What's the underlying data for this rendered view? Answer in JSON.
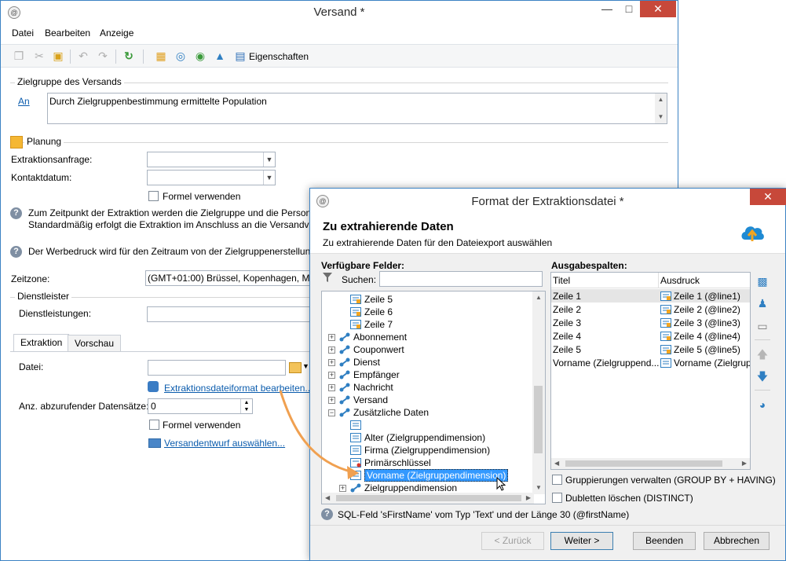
{
  "main_window": {
    "title": "Versand *",
    "menu": [
      "Datei",
      "Bearbeiten",
      "Anzeige"
    ],
    "toolbar": {
      "properties_label": "Eigenschaften"
    },
    "target": {
      "group_label": "Zielgruppe des Versands",
      "to_link": "An",
      "population_text": "Durch Zielgruppenbestimmung ermittelte Population"
    },
    "planning": {
      "label": "Planung",
      "extraction_request_label": "Extraktionsanfrage:",
      "contact_date_label": "Kontaktdatum:",
      "formula_checkbox": "Formel verwenden",
      "info1_line1": "Zum Zeitpunkt der Extraktion werden die Zielgruppe und die Person",
      "info1_line2": "Standardmäßig erfolgt die Extraktion im Anschluss an die Versandva",
      "info2": "Der Werbedruck wird für den Zeitraum von der Zielgruppenerstellun"
    },
    "timezone": {
      "label": "Zeitzone:",
      "value": "(GMT+01:00) Brüssel, Kopenhagen, Ma"
    },
    "service_provider": {
      "group_label": "Dienstleister",
      "services_label": "Dienstleistungen:"
    },
    "tabs": [
      "Extraktion",
      "Vorschau"
    ],
    "extraction": {
      "file_label": "Datei:",
      "format_link": "Extraktionsdateiformat bearbeiten...",
      "records_label": "Anz. abzurufender Datensätze:",
      "records_value": "0",
      "formula_checkbox": "Formel verwenden",
      "template_link": "Versandentwurf auswählen..."
    }
  },
  "dialog": {
    "title": "Format der Extraktionsdatei *",
    "heading": "Zu extrahierende Daten",
    "subheading": "Zu extrahierende Daten für den Dateiexport auswählen",
    "available_label": "Verfügbare Felder:",
    "search_label": "Suchen:",
    "search_value": "",
    "tree": [
      {
        "label": "Zeile 5",
        "indent": 2,
        "type": "line"
      },
      {
        "label": "Zeile 6",
        "indent": 2,
        "type": "line"
      },
      {
        "label": "Zeile 7",
        "indent": 2,
        "type": "line"
      },
      {
        "label": "Abonnement",
        "indent": 1,
        "type": "link",
        "expander": "+"
      },
      {
        "label": "Couponwert",
        "indent": 1,
        "type": "link",
        "expander": "+"
      },
      {
        "label": "Dienst",
        "indent": 1,
        "type": "link",
        "expander": "+"
      },
      {
        "label": "Empfänger",
        "indent": 1,
        "type": "link",
        "expander": "+"
      },
      {
        "label": "Nachricht",
        "indent": 1,
        "type": "link",
        "expander": "+"
      },
      {
        "label": "Versand",
        "indent": 1,
        "type": "link",
        "expander": "+"
      },
      {
        "label": "Zusätzliche Daten",
        "indent": 1,
        "type": "link",
        "expander": "−"
      },
      {
        "label": "",
        "indent": 2,
        "type": "field"
      },
      {
        "label": "Alter (Zielgruppendimension)",
        "indent": 2,
        "type": "field"
      },
      {
        "label": "Firma (Zielgruppendimension)",
        "indent": 2,
        "type": "field"
      },
      {
        "label": "Primärschlüssel",
        "indent": 2,
        "type": "key"
      },
      {
        "label": "Vorname (Zielgruppendimension)",
        "indent": 2,
        "type": "field",
        "selected": true
      },
      {
        "label": "Zielgruppendimension",
        "indent": 2,
        "type": "link",
        "expander": "+"
      }
    ],
    "output_label": "Ausgabespalten:",
    "output_columns": [
      "Titel",
      "Ausdruck"
    ],
    "output_rows": [
      {
        "title": "Zeile 1",
        "expression": "Zeile 1 (@line1)"
      },
      {
        "title": "Zeile 2",
        "expression": "Zeile 2 (@line2)"
      },
      {
        "title": "Zeile 3",
        "expression": "Zeile 3 (@line3)"
      },
      {
        "title": "Zeile 4",
        "expression": "Zeile 4 (@line4)"
      },
      {
        "title": "Zeile 5",
        "expression": "Zeile 5 (@line5)"
      },
      {
        "title": "Vorname (Zielgruppend...",
        "expression": "Vorname (Zielgrup"
      }
    ],
    "group_by_checkbox": "Gruppierungen verwalten (GROUP BY + HAVING)",
    "distinct_checkbox": "Dubletten löschen (DISTINCT)",
    "sql_info": "SQL-Feld 'sFirstName' vom Typ 'Text' und der Länge 30 (@firstName)",
    "buttons": {
      "back": "< Zurück",
      "next": "Weiter >",
      "finish": "Beenden",
      "cancel": "Abbrechen"
    }
  },
  "colors": {
    "accent": "#3c83c4",
    "link": "#0b5cad",
    "close": "#c7483a",
    "arrow": "#f0a050"
  }
}
